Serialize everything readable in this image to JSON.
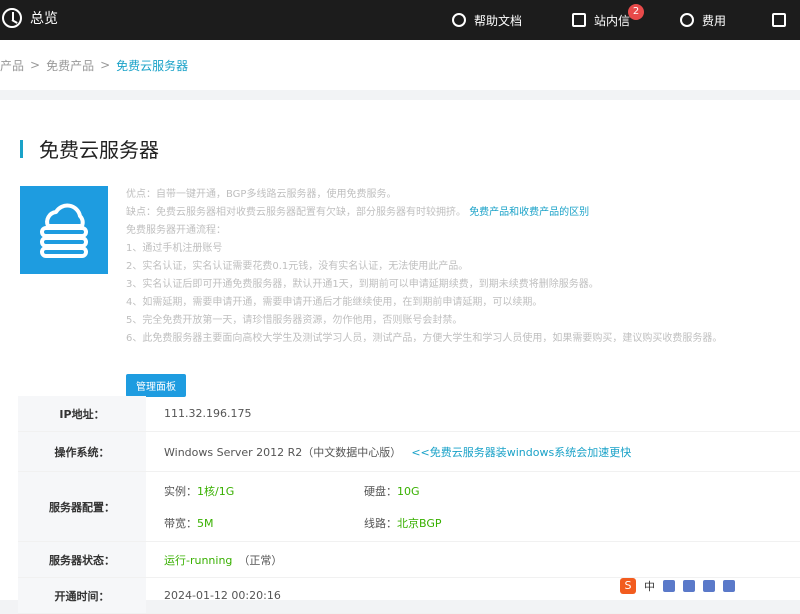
{
  "header": {
    "title": "总览",
    "nav": [
      {
        "label": "帮助文档",
        "icon": "help-icon"
      },
      {
        "label": "站内信",
        "icon": "message-icon",
        "badge": "2"
      },
      {
        "label": "费用",
        "icon": "fee-icon"
      },
      {
        "label": "",
        "icon": "menu-icon"
      }
    ]
  },
  "breadcrumb": {
    "items": [
      "产品",
      ">",
      "免费产品",
      ">"
    ],
    "active": "免费云服务器"
  },
  "page": {
    "title": "免费云服务器",
    "description": [
      "优点：自带一键开通，BGP多线路云服务器，使用免费服务。",
      "缺点：免费云服务器相对收费云服务器配置有欠缺，部分服务器有时较拥挤。",
      "免费服务器开通流程：",
      "1、通过手机注册账号",
      "2、实名认证，实名认证需要花费0.1元钱，没有实名认证，无法使用此产品。",
      "3、实名认证后即可开通免费服务器，默认开通1天，到期前可以申请延期续费，到期未续费将删除服务器。",
      "4、如需延期，需要申请开通，需要申请开通后才能继续使用，在到期前申请延期，可以续期。",
      "5、完全免费开放第一天，请珍惜服务器资源，勿作他用，否则账号会封禁。",
      "6、此免费服务器主要面向高校大学生及测试学习人员，测试产品，方便大学生和学习人员使用，如果需要购买，建议购买收费服务器。"
    ],
    "link_text": "免费产品和收费产品的区别",
    "tag_button": "管理面板"
  },
  "info": {
    "ip_label": "IP地址：",
    "ip_value": "111.32.196.175",
    "os_label": "操作系统：",
    "os_value": "Windows Server 2012 R2（中文数据中心版）",
    "os_link": "<<免费云服务器装windows系统会加速更快",
    "config_label": "服务器配置：",
    "config": {
      "cpu_label": "实例：",
      "cpu_value": "1核/1G",
      "disk_label": "硬盘：",
      "disk_value": "10G",
      "bw_label": "带宽：",
      "bw_value": "5M",
      "line_label": "线路：",
      "line_value": "北京BGP"
    },
    "status_label": "服务器状态：",
    "status_value": "运行-running",
    "status_note": "（正常）",
    "time_label": "开通时间：",
    "time_value": "2024-01-12 00:20:16"
  },
  "overlay": {
    "sogou": "S",
    "text": "中"
  }
}
